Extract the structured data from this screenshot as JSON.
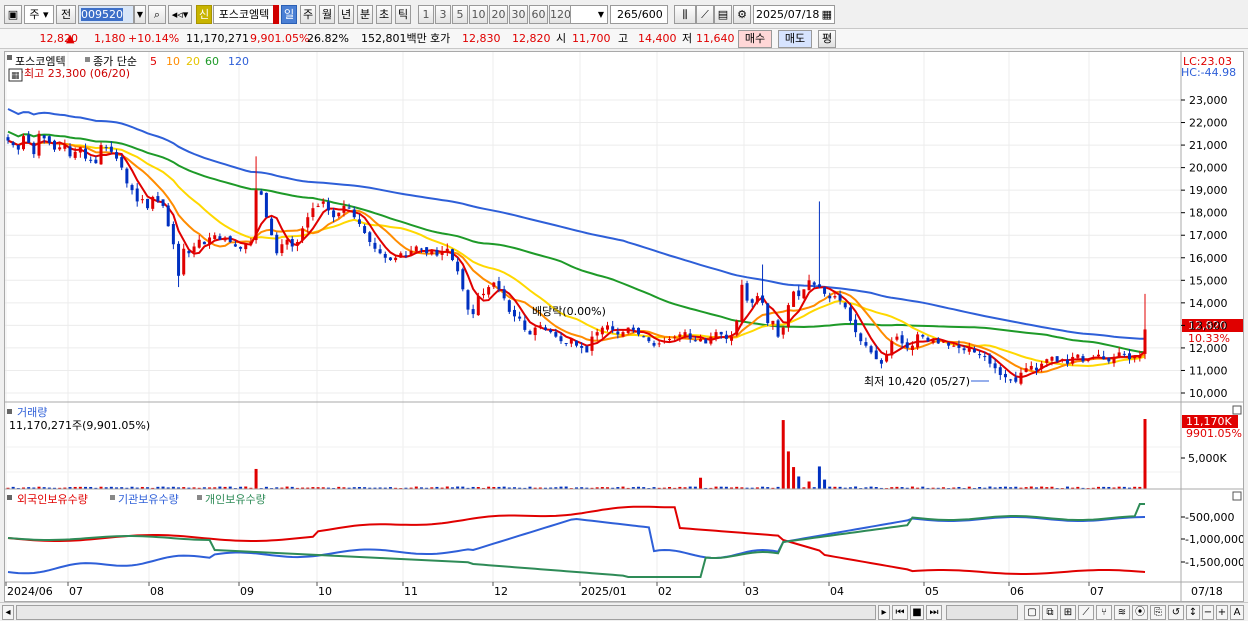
{
  "toolbar": {
    "period_select": "주",
    "prev_label": "전",
    "stock_code": "009520",
    "mode_label": "신",
    "stock_name": "포스코엠텍",
    "period_buttons": [
      "일",
      "주",
      "월",
      "년",
      "분",
      "초",
      "틱"
    ],
    "interval_buttons": [
      "1",
      "3",
      "5",
      "10",
      "20",
      "30",
      "60",
      "120"
    ],
    "count": "265",
    "count_max": "/600",
    "date": "2025/07/18"
  },
  "quote": {
    "price": "12,820",
    "change": "1,180",
    "change_pct": "+10.14%",
    "volume": "11,170,271",
    "volume_ratio": "9,901.05%",
    "turnover": "26.82%",
    "amount": "152,801백만",
    "bid_label": "호가",
    "bid_price": "12,830",
    "ask_price": "12,820",
    "open_label": "시",
    "open": "11,700",
    "high_label": "고",
    "high": "14,400",
    "low_label": "저",
    "low": "11,640",
    "buy_label": "매수",
    "sell_label": "매도",
    "eval_label": "평"
  },
  "legend": {
    "name": "포스코엠텍",
    "type_label": "종가 단순",
    "ma5": "5",
    "ma10": "10",
    "ma20": "20",
    "ma60": "60",
    "ma120": "120"
  },
  "price_panel": {
    "high_note": "최고 23,300 (06/20)",
    "low_note": "최저 10,420 (05/27)",
    "dividend_note": "배당락(0.00%)",
    "lc_label": "LC:23.03",
    "hc_label": "HC:-44.98",
    "current_tag": "12,820",
    "current_pct": "10.33%",
    "axis_labels": [
      "23,000",
      "22,000",
      "21,000",
      "20,000",
      "19,000",
      "18,000",
      "17,000",
      "16,000",
      "15,000",
      "14,000",
      "13,000",
      "12,000",
      "11,000",
      "10,000"
    ]
  },
  "volume_panel": {
    "title": "거래량",
    "value": "11,170,271주(9,901.05%)",
    "current_tag": "11,170K",
    "current_pct": "9901.05%",
    "axis_label": "5,000K"
  },
  "holding_panel": {
    "legend_foreign": "외국인보유수량",
    "legend_inst": "기관보유수량",
    "legend_indiv": "개인보유수량",
    "axis_labels": [
      "-500,000",
      "-1,000,000",
      "-1,500,000"
    ]
  },
  "x_axis": {
    "labels": [
      "2024/06",
      "07",
      "08",
      "09",
      "10",
      "11",
      "12",
      "2025/01",
      "02",
      "03",
      "04",
      "05",
      "06",
      "07"
    ],
    "right_label": "07/18"
  },
  "colors": {
    "up": "#e00000",
    "down": "#0030c0",
    "ma5": "#e00000",
    "ma10": "#ff8c00",
    "ma20": "#ffd800",
    "ma60": "#1e9a28",
    "ma120": "#2e5fd8",
    "foreign": "#e00000",
    "inst": "#2e5fd8",
    "indiv": "#2e8b57"
  },
  "chart_data": {
    "type": "candlestick",
    "title": "포스코엠텍",
    "ylim": [
      10000,
      23300
    ],
    "candle_closes": [
      21200,
      21000,
      20800,
      21400,
      21100,
      20600,
      21500,
      21300,
      21100,
      20800,
      20900,
      21000,
      20500,
      20700,
      20900,
      20400,
      20300,
      20200,
      21000,
      20900,
      20700,
      20400,
      20000,
      19300,
      19000,
      18500,
      18600,
      18200,
      18700,
      18500,
      18300,
      17400,
      16600,
      15200,
      16400,
      16200,
      16500,
      16800,
      16600,
      16900,
      17000,
      16800,
      16900,
      16700,
      16500,
      16400,
      16600,
      16700,
      19000,
      18800,
      17800,
      17000,
      16200,
      16600,
      16800,
      16500,
      16700,
      17300,
      17800,
      18200,
      18300,
      18500,
      18100,
      17800,
      18000,
      18300,
      18200,
      17800,
      17500,
      17100,
      16700,
      16400,
      16200,
      16000,
      15900,
      16000,
      16200,
      16100,
      16300,
      16500,
      16400,
      16200,
      16300,
      16100,
      16300,
      16400,
      15900,
      15400,
      14600,
      13700,
      13500,
      14300,
      14400,
      14700,
      14900,
      14600,
      14200,
      13600,
      13400,
      13300,
      12800,
      12600,
      12900,
      13000,
      12800,
      12700,
      12500,
      12300,
      12200,
      12400,
      12100,
      12000,
      11800,
      12500,
      12700,
      12900,
      13000,
      12800,
      12600,
      12700,
      12900,
      12800,
      12600,
      12500,
      12300,
      12100,
      12200,
      12300,
      12400,
      12500,
      12600,
      12700,
      12400,
      12300,
      12400,
      12200,
      12500,
      12700,
      12600,
      12400,
      12500,
      13200,
      14800,
      14100,
      14000,
      14300,
      14000,
      13100,
      13200,
      12500,
      12900,
      13900,
      14500,
      14300,
      14600,
      15000,
      14800,
      14700,
      14400,
      14200,
      14300,
      14100,
      13800,
      13200,
      12700,
      12300,
      12100,
      11800,
      11500,
      11300,
      11700,
      12300,
      12500,
      12200,
      12000,
      12100,
      12600,
      12500,
      12300,
      12400,
      12200,
      12300,
      12100,
      12100,
      12000,
      11900,
      12000,
      11800,
      11700,
      11600,
      11300,
      11100,
      10800,
      10700,
      10600,
      10500,
      10900,
      11100,
      11200,
      11000,
      11300,
      11500,
      11600,
      11400,
      11500,
      11300,
      11600,
      11700,
      11400,
      11500,
      11600,
      11700,
      11500,
      11400,
      11600,
      11800,
      11700,
      11500,
      11600,
      11640,
      12820
    ],
    "volume_spikes": [
      {
        "date": "2024/09",
        "value": 3200
      },
      {
        "date": "2025/01",
        "value": 1800
      },
      {
        "date": "2025/02",
        "value": 11000
      },
      {
        "date": "2025/03",
        "value": 3600
      },
      {
        "date": "2025/07/18",
        "value": 11170
      }
    ]
  }
}
